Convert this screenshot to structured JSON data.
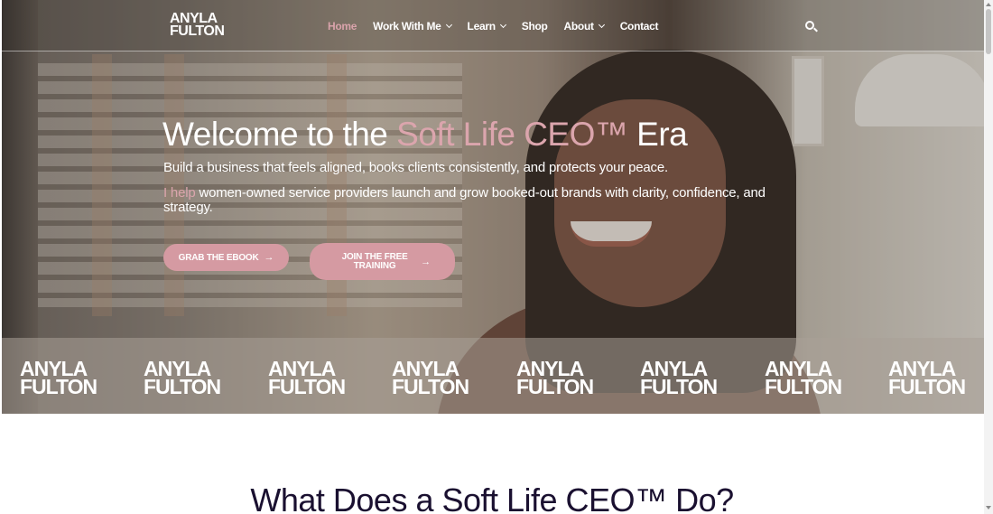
{
  "brand": {
    "line1": "ANYLA",
    "line2": "FULTON"
  },
  "nav": {
    "items": [
      {
        "label": "Home",
        "active": true,
        "dropdown": false
      },
      {
        "label": "Work With Me",
        "active": false,
        "dropdown": true
      },
      {
        "label": "Learn",
        "active": false,
        "dropdown": true
      },
      {
        "label": "Shop",
        "active": false,
        "dropdown": false
      },
      {
        "label": "About",
        "active": false,
        "dropdown": true
      },
      {
        "label": "Contact",
        "active": false,
        "dropdown": false
      }
    ],
    "search_icon": "search-icon"
  },
  "hero": {
    "headline_pre": "Welcome to the ",
    "headline_accent": "Soft Life CEO™",
    "headline_post": " Era",
    "subheading": "Build a business that feels aligned, books clients consistently, and protects your peace.",
    "intro_accent": "I help",
    "intro_text": " women-owned service providers launch and grow booked-out brands with clarity, confidence, and strategy.",
    "button_ebook": "GRAB THE EBOOK",
    "button_training": "JOIN THE FREE TRAINING",
    "arrow": "→"
  },
  "logo_strip": {
    "count": 8
  },
  "section": {
    "title": "What Does a Soft Life CEO™ Do?"
  },
  "colors": {
    "accent": "#d59aa2",
    "heading": "#1a1030",
    "white": "#ffffff"
  }
}
